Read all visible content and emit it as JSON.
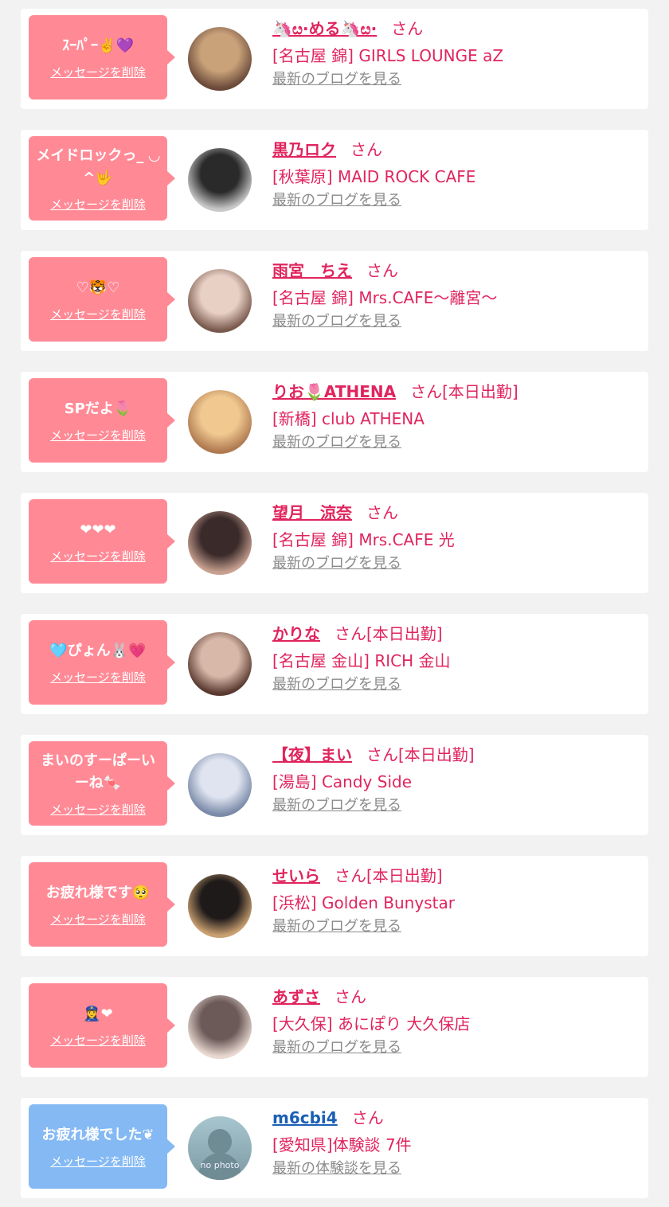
{
  "entries": [
    {
      "message": "ｽｰﾊﾟｰ✌️💜",
      "delete": "メッセージを削除",
      "name": "🦄ೞ·める🦄ೞ·",
      "san": "さん",
      "tag": "",
      "shop": "[名古屋 錦] GIRLS LOUNGE aZ",
      "blog": "最新のブログを見る",
      "bubble": "pink",
      "avatar": "avatar-photo"
    },
    {
      "message": "メイドロックっ_ ◡^🤟",
      "delete": "メッセージを削除",
      "name": "黒乃ロク",
      "san": "さん",
      "tag": "",
      "shop": "[秋葉原] MAID ROCK CAFE",
      "blog": "最新のブログを見る",
      "bubble": "pink",
      "avatar": "avatar-photo"
    },
    {
      "message": "♡🐯♡",
      "delete": "メッセージを削除",
      "name": "雨宮　ちえ",
      "san": "さん",
      "tag": "",
      "shop": "[名古屋 錦] Mrs.CAFE〜離宮〜",
      "blog": "最新のブログを見る",
      "bubble": "pink",
      "avatar": "avatar-photo"
    },
    {
      "message": "SPだよ🌷",
      "delete": "メッセージを削除",
      "name": "りお🌷ATHENA",
      "san": "さん",
      "tag": "[本日出勤]",
      "shop": "[新橋] club ATHENA",
      "blog": "最新のブログを見る",
      "bubble": "pink",
      "avatar": "avatar-photo"
    },
    {
      "message": "❤︎❤︎❤︎",
      "delete": "メッセージを削除",
      "name": "望月　涼奈",
      "san": "さん",
      "tag": "",
      "shop": "[名古屋 錦] Mrs.CAFE 光",
      "blog": "最新のブログを見る",
      "bubble": "pink",
      "avatar": "avatar-photo"
    },
    {
      "message": "🩵ぴょん🐰💗",
      "delete": "メッセージを削除",
      "name": "かりな",
      "san": "さん",
      "tag": "[本日出勤]",
      "shop": "[名古屋 金山] RICH 金山",
      "blog": "最新のブログを見る",
      "bubble": "pink",
      "avatar": "avatar-photo"
    },
    {
      "message": "まいのすーぱーいーね🍬",
      "delete": "メッセージを削除",
      "name": "【夜】まい",
      "san": "さん",
      "tag": "[本日出勤]",
      "shop": "[湯島] Candy Side",
      "blog": "最新のブログを見る",
      "bubble": "pink",
      "avatar": "avatar-photo"
    },
    {
      "message": "お疲れ様です🥺",
      "delete": "メッセージを削除",
      "name": "せいら",
      "san": "さん",
      "tag": "[本日出勤]",
      "shop": "[浜松] Golden Bunystar",
      "blog": "最新のブログを見る",
      "bubble": "pink",
      "avatar": "avatar-photo"
    },
    {
      "message": "👮‍♀️❤︎",
      "delete": "メッセージを削除",
      "name": "あずさ",
      "san": "さん",
      "tag": "",
      "shop": "[大久保] あにぽり 大久保店",
      "blog": "最新のブログを見る",
      "bubble": "pink",
      "avatar": "avatar-photo"
    },
    {
      "message": "お疲れ様でした❦",
      "delete": "メッセージを削除",
      "name": "m6cbi4",
      "san": "さん",
      "tag": "",
      "shop": "[愛知県]体験談 7件",
      "blog": "最新の体験談を見る",
      "bubble": "blue",
      "avatar": "no-photo",
      "nophoto_text": "no photo"
    }
  ],
  "colors": {
    "pink_bubble": "#ff8a96",
    "blue_bubble": "#84b9f4",
    "name_pink": "#e0245e",
    "name_blue": "#1a5fb4"
  },
  "avatar_palettes": [
    [
      "#c9a27a",
      "#6b4a3a"
    ],
    [
      "#2a2a2a",
      "#c8c8c8"
    ],
    [
      "#e8d0c4",
      "#7a5a4e"
    ],
    [
      "#f0c890",
      "#b07a50"
    ],
    [
      "#3a2a2a",
      "#c8a090"
    ],
    [
      "#d8b8a8",
      "#5a3a30"
    ],
    [
      "#dfe4f0",
      "#7a8aa8"
    ],
    [
      "#1e1a1a",
      "#caa070"
    ],
    [
      "#6b5a58",
      "#e8d8d0"
    ]
  ]
}
